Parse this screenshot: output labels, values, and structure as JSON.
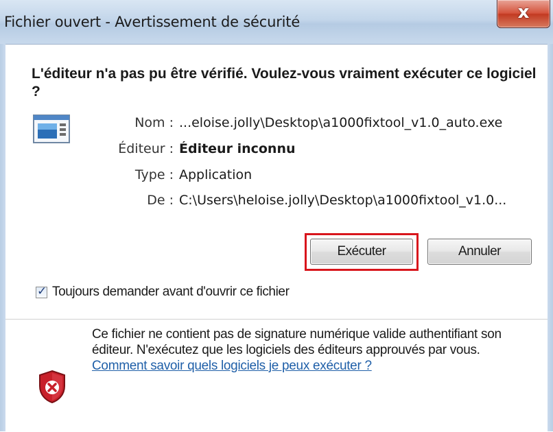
{
  "window": {
    "title": "Fichier ouvert - Avertissement de sécurité",
    "close_glyph": "x"
  },
  "dialog": {
    "heading": "L'éditeur n'a pas pu être vérifié. Voulez-vous vraiment exécuter ce logiciel ?",
    "fields": [
      {
        "label": "Nom :",
        "value": "...eloise.jolly\\Desktop\\a1000fixtool_v1.0_auto.exe"
      },
      {
        "label": "Éditeur :",
        "value": "Éditeur inconnu"
      },
      {
        "label": "Type :",
        "value": "Application"
      },
      {
        "label": "De :",
        "value": "C:\\Users\\heloise.jolly\\Desktop\\a1000fixtool_v1.0..."
      }
    ],
    "buttons": {
      "run": "Exécuter",
      "cancel": "Annuler"
    },
    "checkbox": {
      "label": "Toujours demander avant d'ouvrir ce fichier",
      "checked": true
    },
    "warning": {
      "text": "Ce fichier ne contient pas de signature numérique valide authentifiant son éditeur. N'exécutez que les logiciels des éditeurs approuvés par vous. ",
      "link": "Comment savoir quels logiciels je peux exécuter ?"
    }
  },
  "icons": {
    "app": "application-icon",
    "shield": "security-shield-icon",
    "close": "close-icon",
    "check": "checkmark-icon"
  },
  "colors": {
    "highlight": "#d8151c",
    "link": "#1f5fa8",
    "shield_red": "#c8202a"
  }
}
